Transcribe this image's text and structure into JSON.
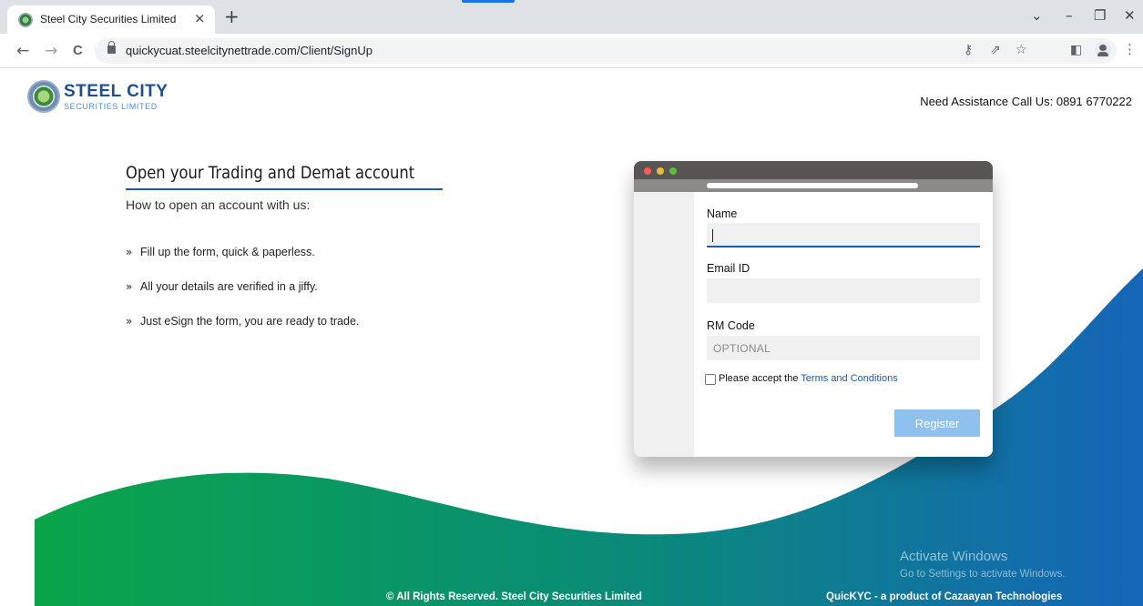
{
  "browser": {
    "tab_title": "Steel City Securities Limited",
    "tab_close": "×",
    "new_tab": "+",
    "url": "quickycuat.steelcitynettrade.com/Client/SignUp",
    "window_controls": {
      "chevron": "⌄",
      "minimize": "–",
      "restore": "❐",
      "close": "✕"
    },
    "nav": {
      "back": "←",
      "forward": "→",
      "reload": "C"
    },
    "omnibox_icons": {
      "key": "⚷",
      "share": "⇗",
      "star": "☆",
      "sidepanel": "◧"
    },
    "menu": "⋮"
  },
  "header": {
    "brand_name": "STEEL CITY",
    "brand_sub": "SECURITIES LIMITED",
    "assistance": "Need Assistance Call Us: 0891 6770222"
  },
  "hero": {
    "title": "Open your Trading and Demat account",
    "subtitle": "How to open an account with us:",
    "bullet": "»",
    "steps": [
      "Fill up the form, quick & paperless.",
      "All your details are verified in a jiffy.",
      "Just eSign the form, you are ready to trade."
    ]
  },
  "form": {
    "name_label": "Name",
    "name_value": "",
    "email_label": "Email ID",
    "email_value": "",
    "rm_label": "RM Code",
    "rm_placeholder": "OPTIONAL",
    "terms_prefix": "Please accept the ",
    "terms_link": "Terms and Conditions",
    "register_label": "Register"
  },
  "footer": {
    "copyright": "© All Rights Reserved. Steel City Securities Limited",
    "product": "QuicKYC - a product of Cazaayan Technologies"
  },
  "watermark": {
    "title": "Activate Windows",
    "subtitle": "Go to Settings to activate Windows."
  },
  "colors": {
    "brand_blue": "#1f4f8e",
    "wave_green": "#0aa54a",
    "wave_blue": "#1565b8",
    "register_button": "#8fc1ee",
    "traffic_red": "#fc5b57",
    "traffic_yellow": "#e5bf3c",
    "traffic_green": "#57c038"
  }
}
